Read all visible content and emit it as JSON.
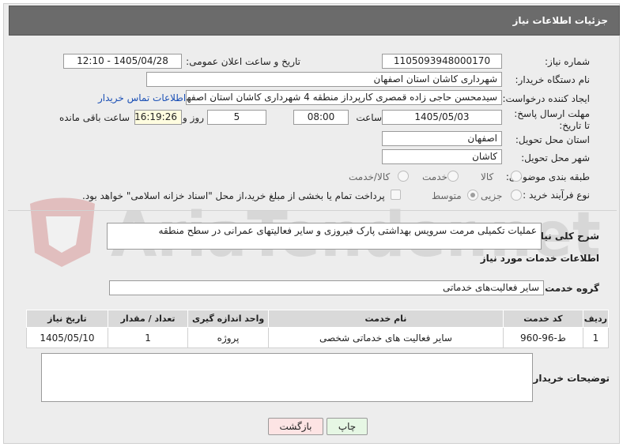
{
  "header": {
    "title": "جزئیات اطلاعات نیاز"
  },
  "fields": {
    "need_number_label": "شماره نیاز:",
    "need_number": "1105093948000170",
    "announce_label": "تاریخ و ساعت اعلان عمومی:",
    "announce_value": "1405/04/28 - 12:10",
    "buyer_org_label": "نام دستگاه خریدار:",
    "buyer_org": "شهرداری کاشان استان اصفهان",
    "creator_label": "ایجاد کننده درخواست:",
    "creator": "سیدمحسن حاجی زاده قمصری کارپرداز منطقه 4 شهرداری کاشان استان اصفهان",
    "contact_link": "اطلاعات تماس خریدار",
    "deadline_label": "مهلت ارسال پاسخ: تا تاریخ:",
    "deadline_date": "1405/05/03",
    "time_label": "ساعت",
    "deadline_time": "08:00",
    "days_value": "5",
    "days_label": "روز و",
    "remaining_time": "16:19:26",
    "remaining_label": "ساعت باقی مانده",
    "province_label": "استان محل تحویل:",
    "province": "اصفهان",
    "city_label": "شهر محل تحویل:",
    "city": "کاشان",
    "category_label": "طبقه بندی موضوعی:",
    "category_options": [
      "کالا",
      "خدمت",
      "کالا/خدمت"
    ],
    "process_label": "نوع فرآیند خرید :",
    "process_options": [
      "جزیی",
      "متوسط"
    ],
    "payment_note": "پرداخت تمام یا بخشی از مبلغ خرید،از محل \"اسناد خزانه اسلامی\" خواهد بود."
  },
  "summary": {
    "label": "شرح کلی نیاز:",
    "text": "عملیات تکمیلی مرمت سرویس بهداشتی پارک فیروزی و سایر فعالیتهای عمرانی در سطح منطقه"
  },
  "services": {
    "section_title": "اطلاعات خدمات مورد نیاز",
    "group_label": "گروه خدمت:",
    "group_value": "سایر فعالیت‌های خدماتی",
    "columns": [
      "ردیف",
      "کد خدمت",
      "نام خدمت",
      "واحد اندازه گیری",
      "تعداد / مقدار",
      "تاریخ نیاز"
    ],
    "rows": [
      {
        "row": "1",
        "code": "ط-96-960",
        "name": "سایر فعالیت های خدماتی شخصی",
        "unit": "پروژه",
        "qty": "1",
        "date": "1405/05/10"
      }
    ]
  },
  "buyer_notes": {
    "label": "توضیحات خریدار:",
    "text": ""
  },
  "buttons": {
    "print": "چاپ",
    "back": "بازگشت"
  },
  "watermark": {
    "text": "AriaTender.net"
  },
  "colors": {
    "titlebar": "#6b6b6b",
    "link": "#1a4fb5",
    "print_btn": "#e6f7e4",
    "back_btn": "#fde4e4"
  }
}
